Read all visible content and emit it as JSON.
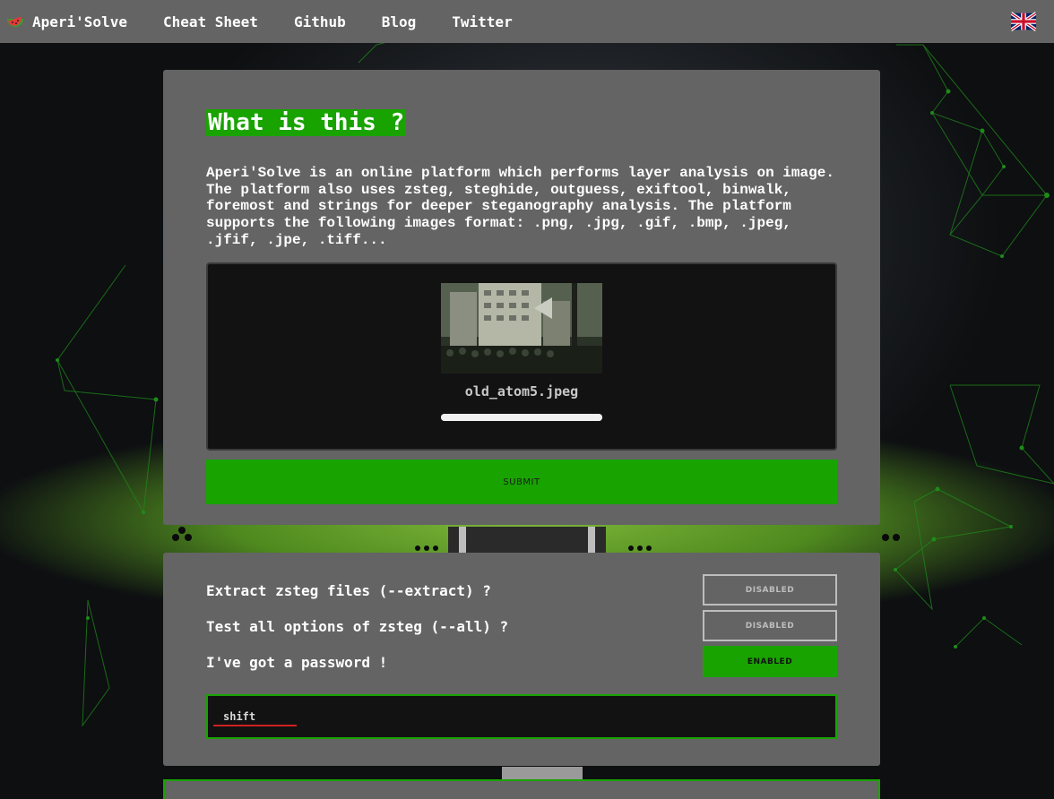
{
  "nav": {
    "brand": "Aperi'Solve",
    "links": [
      "Cheat Sheet",
      "Github",
      "Blog",
      "Twitter"
    ],
    "language_icon": "uk-flag-icon"
  },
  "upload_card": {
    "title": "What is this ?",
    "description": "Aperi'Solve is an online platform which performs layer analysis on image.\nThe platform also uses zsteg, steghide, outguess, exiftool, binwalk,\nforemost and strings for deeper steganography analysis. The platform\nsupports the following images format: .png, .jpg, .gif, .bmp, .jpeg,\n.jfif, .jpe, .tiff...",
    "file_name": "old_atom5.jpeg",
    "upload_progress": 1.0,
    "submit_label": "SUBMIT"
  },
  "options_card": {
    "options": [
      {
        "label": "Extract zsteg files (--extract) ?",
        "state": "DISABLED"
      },
      {
        "label": "Test all options of zsteg (--all) ?",
        "state": "DISABLED"
      },
      {
        "label": "I've got a password !",
        "state": "ENABLED"
      }
    ],
    "password_value": "shift"
  },
  "colors": {
    "accent_green": "#18a300",
    "card_gray": "#646464",
    "input_underline": "#d02020"
  }
}
